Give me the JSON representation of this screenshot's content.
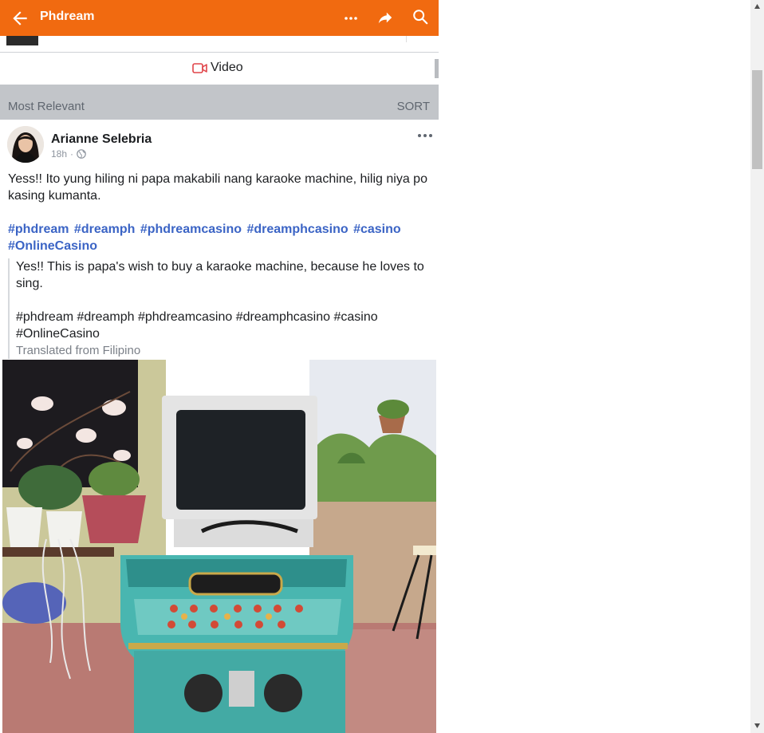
{
  "topbar": {
    "title": "Phdream",
    "icons": [
      "back-arrow-icon",
      "more-dots-icon",
      "share-icon",
      "search-icon"
    ],
    "color": "#f16a10"
  },
  "video_row": {
    "label": "Video",
    "icon": "video-camera-icon",
    "icon_color": "#e0454a"
  },
  "comments_header": {
    "label": "Most Relevant",
    "sort_label": "SORT"
  },
  "post": {
    "author": "Arianne Selebria",
    "time": "18h",
    "separator": "·",
    "privacy_icon": "globe-icon",
    "text": "Yess!! Ito yung hiling ni papa makabili nang karaoke machine, hilig niya po kasing kumanta.",
    "hashtags": [
      "#phdream",
      "#dreamph",
      "#phdreamcasino",
      "#dreamphcasino",
      "#casino",
      "#OnlineCasino"
    ],
    "hashtag_color": "#3b64c5",
    "translation": {
      "text": "Yes!! This is papa's wish to buy a karaoke machine, because he loves to sing.",
      "tags": "#phdream #dreamph #phdreamcasino #dreamphcasino #casino #OnlineCasino",
      "note": "Translated from Filipino"
    }
  }
}
